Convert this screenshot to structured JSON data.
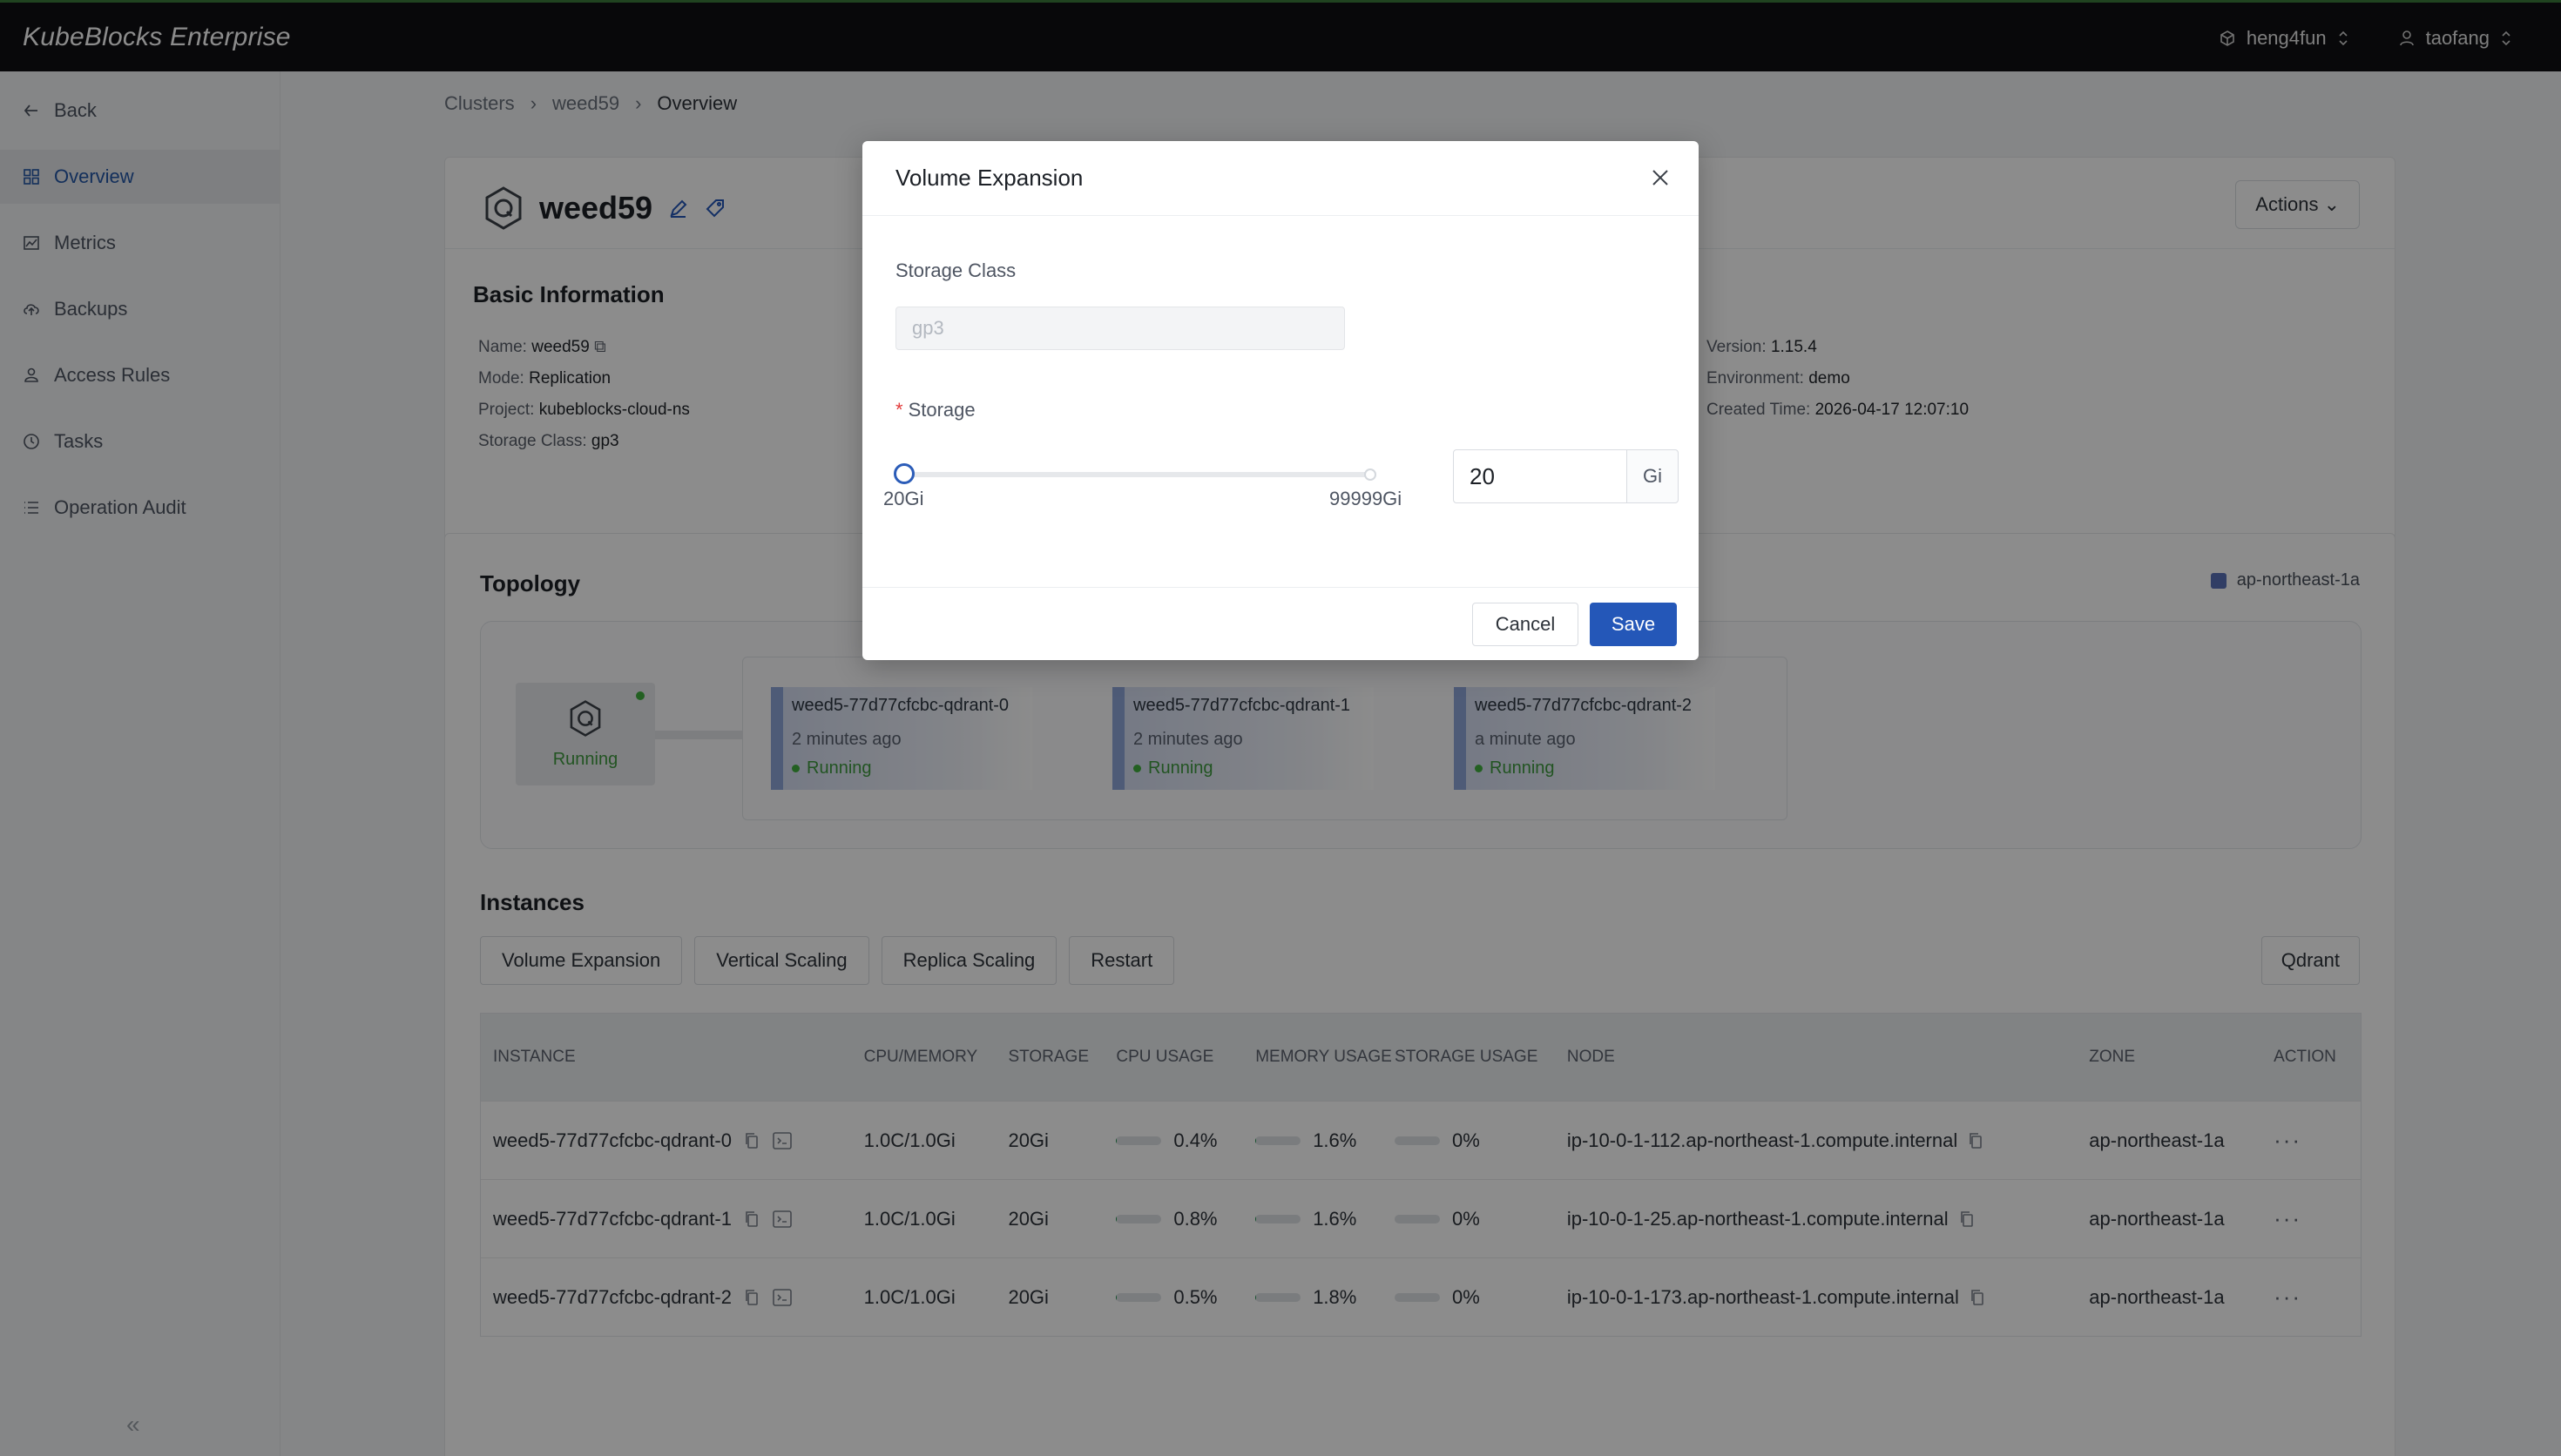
{
  "app": {
    "brand": "KubeBlocks Enterprise",
    "org": "heng4fun",
    "user": "taofang"
  },
  "sidebar": {
    "items": [
      {
        "label": "Back",
        "icon": "arrow-left-icon"
      },
      {
        "label": "Overview",
        "icon": "grid-icon"
      },
      {
        "label": "Metrics",
        "icon": "chart-icon"
      },
      {
        "label": "Backups",
        "icon": "cloud-icon"
      },
      {
        "label": "Access Rules",
        "icon": "users-icon"
      },
      {
        "label": "Tasks",
        "icon": "clock-icon"
      },
      {
        "label": "Operation Audit",
        "icon": "list-icon"
      }
    ],
    "collapse": "«"
  },
  "breadcrumb": [
    "Clusters",
    "weed59",
    "Overview"
  ],
  "cluster": {
    "name": "weed59",
    "actions_label": "Actions",
    "basic_title": "Basic Information",
    "info": {
      "name_label": "Name:",
      "name_value": "weed59",
      "mode_label": "Mode:",
      "mode_value": "Replication",
      "project_label": "Project:",
      "project_value": "kubeblocks-cloud-ns",
      "storage_label": "Storage Class:",
      "storage_value": "gp3",
      "version_label": "Version:",
      "version_value": "1.15.4",
      "env_label": "Environment:",
      "env_value": "demo",
      "created_label": "Created Time:",
      "created_value": "2026-04-17 12:07:10"
    }
  },
  "topology": {
    "title": "Topology",
    "legend": "ap-northeast-1a",
    "main_status": "Running",
    "pods": [
      {
        "name": "weed5-77d77cfcbc-qdrant-0",
        "age": "2 minutes ago",
        "status": "Running"
      },
      {
        "name": "weed5-77d77cfcbc-qdrant-1",
        "age": "2 minutes ago",
        "status": "Running"
      },
      {
        "name": "weed5-77d77cfcbc-qdrant-2",
        "age": "a minute ago",
        "status": "Running"
      }
    ]
  },
  "instances": {
    "title": "Instances",
    "ops": [
      "Volume Expansion",
      "Vertical Scaling",
      "Replica Scaling",
      "Restart"
    ],
    "component": "Qdrant",
    "headers": [
      "INSTANCE",
      "CPU/MEMORY",
      "STORAGE",
      "CPU USAGE",
      "MEMORY USAGE",
      "STORAGE USAGE",
      "NODE",
      "ZONE",
      "ACTION"
    ],
    "rows": [
      {
        "instance": "weed5-77d77cfcbc-qdrant-0",
        "cpu_mem": "1.0C/1.0Gi",
        "storage": "20Gi",
        "cpu": "0.4%",
        "mem": "1.6%",
        "sto": "0%",
        "cpu_frac": 0.004,
        "mem_frac": 0.016,
        "sto_frac": 0,
        "node": "ip-10-0-1-112.ap-northeast-1.compute.internal",
        "zone": "ap-northeast-1a",
        "action": "···"
      },
      {
        "instance": "weed5-77d77cfcbc-qdrant-1",
        "cpu_mem": "1.0C/1.0Gi",
        "storage": "20Gi",
        "cpu": "0.8%",
        "mem": "1.6%",
        "sto": "0%",
        "cpu_frac": 0.008,
        "mem_frac": 0.016,
        "sto_frac": 0,
        "node": "ip-10-0-1-25.ap-northeast-1.compute.internal",
        "zone": "ap-northeast-1a",
        "action": "···"
      },
      {
        "instance": "weed5-77d77cfcbc-qdrant-2",
        "cpu_mem": "1.0C/1.0Gi",
        "storage": "20Gi",
        "cpu": "0.5%",
        "mem": "1.8%",
        "sto": "0%",
        "cpu_frac": 0.005,
        "mem_frac": 0.018,
        "sto_frac": 0,
        "node": "ip-10-0-1-173.ap-northeast-1.compute.internal",
        "zone": "ap-northeast-1a",
        "action": "···"
      }
    ]
  },
  "modal": {
    "title": "Volume Expansion",
    "storage_class_label": "Storage Class",
    "storage_class_placeholder": "gp3",
    "storage_label": "Storage",
    "required_mark": "*",
    "slider_min": "20Gi",
    "slider_max": "99999Gi",
    "slider_value": 20,
    "storage_value": "20",
    "unit": "Gi",
    "cancel": "Cancel",
    "save": "Save"
  },
  "colors": {
    "accent": "#2457b8",
    "running": "#3f9a3f",
    "topbar": "#0f1013"
  }
}
